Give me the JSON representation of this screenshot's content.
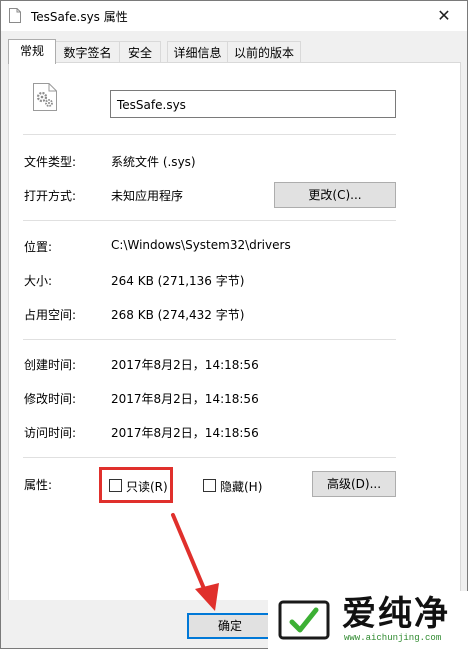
{
  "window": {
    "title": "TesSafe.sys 属性",
    "close_glyph": "✕"
  },
  "tabs": [
    {
      "label": "常规",
      "active": true
    },
    {
      "label": "数字签名"
    },
    {
      "label": "安全"
    },
    {
      "label": "详细信息"
    },
    {
      "label": "以前的版本"
    }
  ],
  "general": {
    "filename": "TesSafe.sys",
    "file_type_label": "文件类型:",
    "file_type_value": "系统文件 (.sys)",
    "open_with_label": "打开方式:",
    "open_with_value": "未知应用程序",
    "change_button": "更改(C)...",
    "location_label": "位置:",
    "location_value": "C:\\Windows\\System32\\drivers",
    "size_label": "大小:",
    "size_value": "264 KB (271,136 字节)",
    "size_on_disk_label": "占用空间:",
    "size_on_disk_value": "268 KB (274,432 字节)",
    "created_label": "创建时间:",
    "created_value": "2017年8月2日，14:18:56",
    "modified_label": "修改时间:",
    "modified_value": "2017年8月2日，14:18:56",
    "accessed_label": "访问时间:",
    "accessed_value": "2017年8月2日，14:18:56",
    "attributes_label": "属性:",
    "readonly_label": "只读(R)",
    "readonly_checked": false,
    "hidden_label": "隐藏(H)",
    "hidden_checked": false,
    "advanced_button": "高级(D)..."
  },
  "footer": {
    "ok_button": "确定"
  },
  "watermark": {
    "title": "爱纯净",
    "url": "www.aichunjing.com"
  },
  "colors": {
    "highlight": "#e0302c",
    "arrow": "#e0302c",
    "focus": "#0078d7",
    "logo_green": "#3cb034"
  }
}
